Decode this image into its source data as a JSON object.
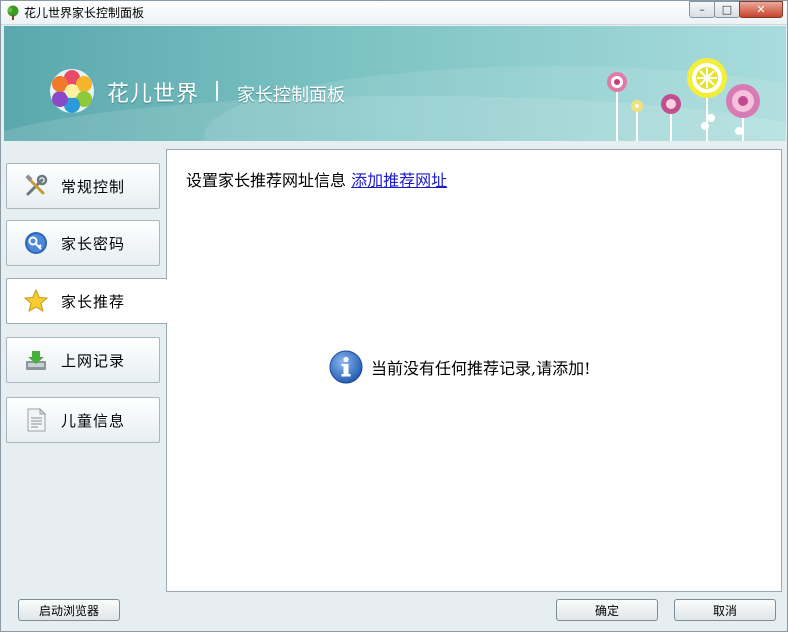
{
  "window": {
    "title": "花儿世界家长控制面板",
    "controls": {
      "minimize": "–",
      "maximize": "□",
      "close": "✕"
    }
  },
  "banner": {
    "brand": "花儿世界",
    "subtitle": "家长控制面板",
    "logo_icon": "flower-logo-icon",
    "decoration": "flowers-illustration"
  },
  "sidebar": {
    "items": [
      {
        "label": "常规控制",
        "icon": "tools-icon",
        "active": false
      },
      {
        "label": "家长密码",
        "icon": "key-icon",
        "active": false
      },
      {
        "label": "家长推荐",
        "icon": "star-icon",
        "active": true
      },
      {
        "label": "上网记录",
        "icon": "download-tray-icon",
        "active": false
      },
      {
        "label": "儿童信息",
        "icon": "document-icon",
        "active": false
      }
    ]
  },
  "content": {
    "heading": "设置家长推荐网址信息",
    "add_link": "添加推荐网址",
    "empty_message": "当前没有任何推荐记录,请添加!",
    "empty_icon": "info-icon"
  },
  "footer": {
    "launch_browser": "启动浏览器",
    "ok": "确定",
    "cancel": "取消"
  },
  "colors": {
    "banner_start": "#5aa8ad",
    "banner_end": "#a9dcdc",
    "link": "#1a1acc",
    "info_blue": "#2f6fc8"
  }
}
